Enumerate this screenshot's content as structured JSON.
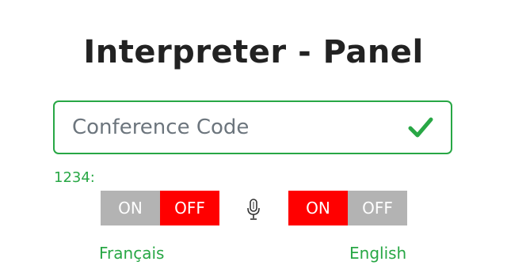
{
  "page": {
    "title": "Interpreter - Panel"
  },
  "conference": {
    "placeholder": "Conference Code",
    "value": "",
    "code_label": "1234:",
    "valid_icon": "check-icon",
    "valid_color": "#28a745"
  },
  "toggles": {
    "left": {
      "on_label": "ON",
      "off_label": "OFF",
      "state": "OFF",
      "language": "Français"
    },
    "right": {
      "on_label": "ON",
      "off_label": "OFF",
      "state": "ON",
      "language": "English"
    },
    "center_icon": "microphone-icon",
    "active_color": "#ff0000",
    "inactive_color": "#b3b3b3"
  }
}
